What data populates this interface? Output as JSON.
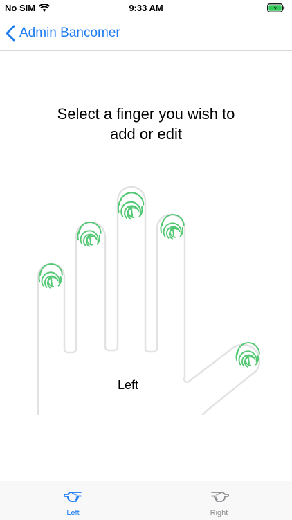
{
  "status_bar": {
    "carrier": "No SIM",
    "time": "9:33 AM",
    "battery": "charging"
  },
  "nav": {
    "back_label": "Admin Bancomer"
  },
  "prompt": {
    "line1": "Select a finger you wish to",
    "line2": "add or edit"
  },
  "hand": {
    "label": "Left",
    "fingers": [
      "pinky",
      "ring",
      "middle",
      "index",
      "thumb"
    ],
    "enrolled_color": "#52c873"
  },
  "tabs": [
    {
      "label": "Left",
      "icon": "left-hand-pointing-icon",
      "selected": true
    },
    {
      "label": "Right",
      "icon": "right-hand-pointing-icon",
      "selected": false
    }
  ],
  "colors": {
    "accent": "#1e7cf2",
    "inactive": "#8e8e93",
    "fingerprint": "#52c873"
  }
}
